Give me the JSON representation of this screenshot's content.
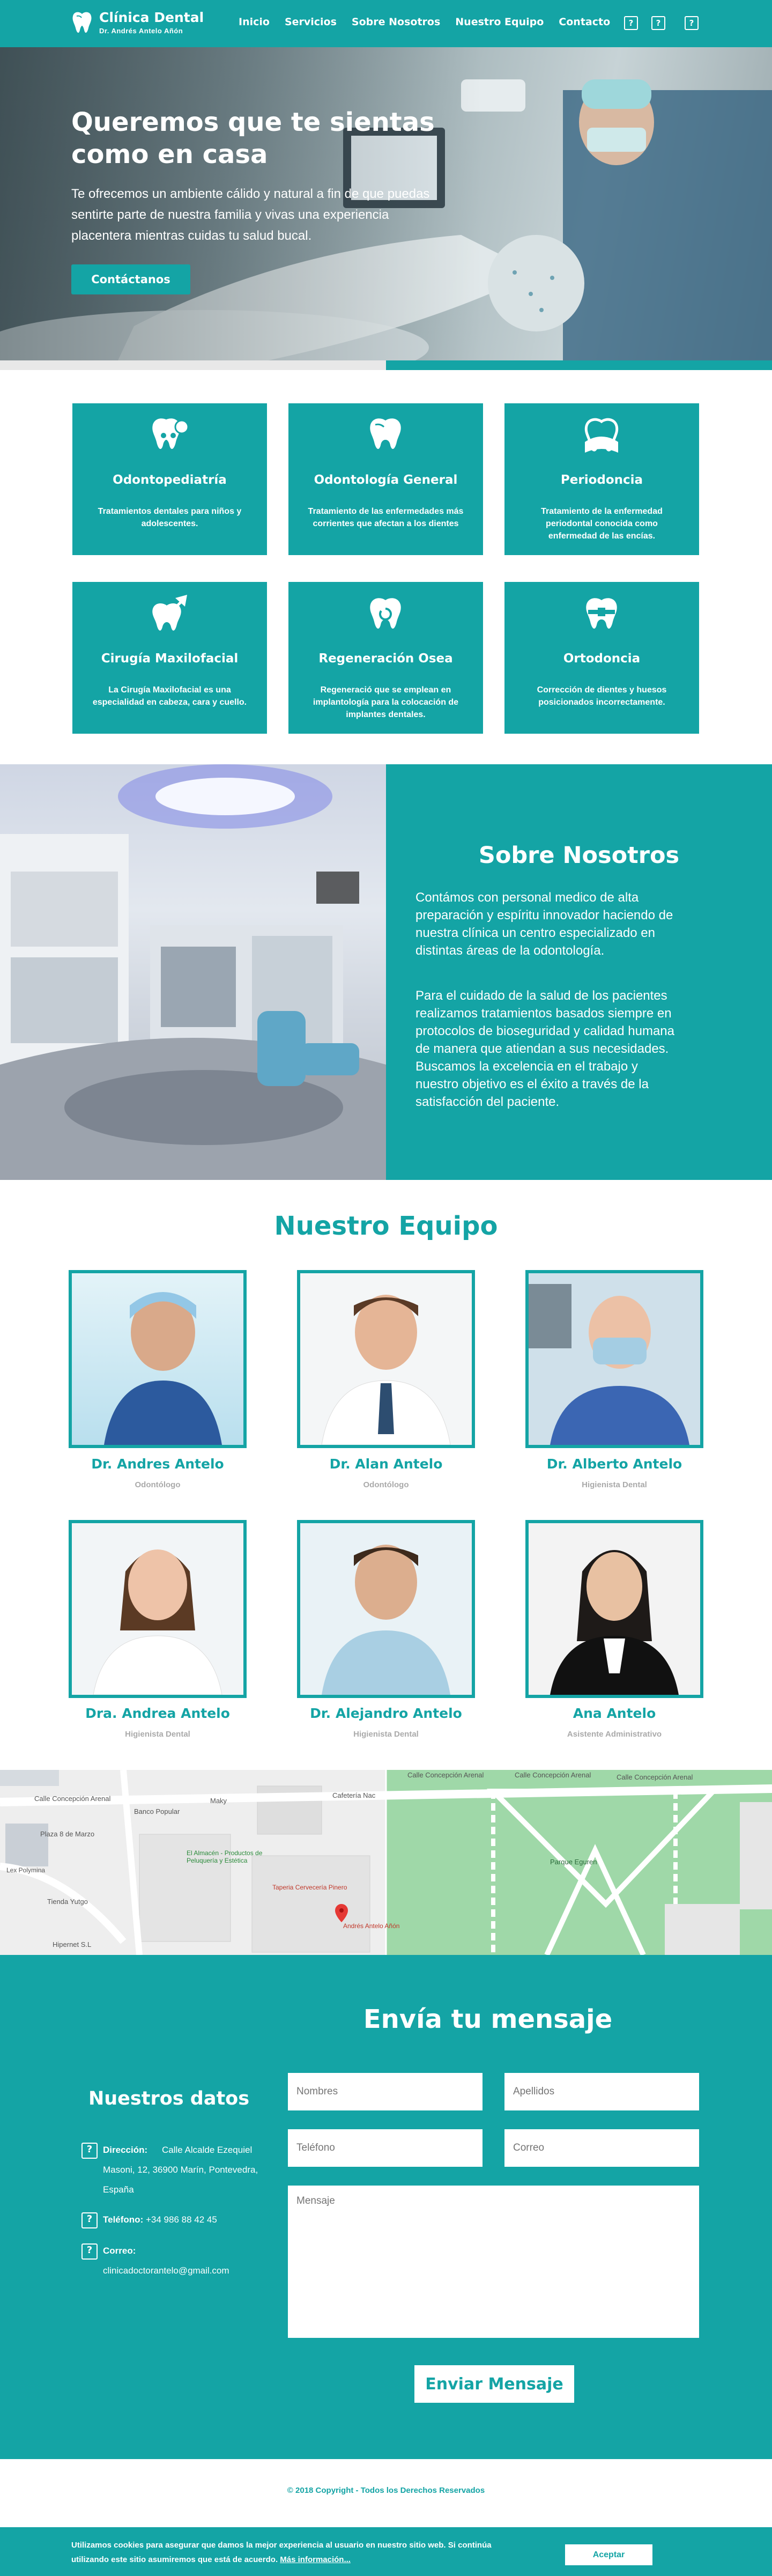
{
  "nav": {
    "brand_title": "Clínica Dental",
    "brand_sub": "Dr.   Andrés Antelo Añón",
    "items": [
      "Inicio",
      "Servicios",
      "Sobre Nosotros",
      "Nuestro Equipo",
      "Contacto"
    ],
    "icons": [
      "?",
      "?",
      "?"
    ]
  },
  "hero": {
    "title": "Queremos que te sientas como en casa",
    "text": "Te ofrecemos un ambiente cálido y natural a fin de que puedas sentirte parte de nuestra familia y vivas una experiencia placentera mientras cuidas tu salud bucal.",
    "button": "Contáctanos"
  },
  "services": [
    {
      "title": "Odontopediatría",
      "desc": "Tratamientos dentales para niños y adolescentes.",
      "icon": "kid-tooth-icon"
    },
    {
      "title": "Odontología General",
      "desc": "Tratamiento de las enfermedades más corrientes que afectan a los dientes",
      "icon": "tooth-icon"
    },
    {
      "title": "Periodoncia",
      "desc": "Tratamiento de la enfermedad periodontal conocida como enfermedad de las encías.",
      "icon": "gum-icon"
    },
    {
      "title": "Cirugía Maxilofacial",
      "desc": "La Cirugía Maxilofacial es una especialidad en cabeza, cara y cuello.",
      "icon": "surgery-tooth-icon"
    },
    {
      "title": "Regeneración Osea",
      "desc": "Regeneració que se emplean en implantología para la colocación de implantes dentales.",
      "icon": "regeneration-tooth-icon"
    },
    {
      "title": "Ortodoncia",
      "desc": "Corrección de dientes y huesos posicionados incorrectamente.",
      "icon": "braces-tooth-icon"
    }
  ],
  "about": {
    "title": "Sobre Nosotros",
    "p1": "Contámos con personal medico de alta preparación y espíritu innovador haciendo de nuestra clínica un centro especializado en distintas áreas de la odontología.",
    "p2": "Para el cuidado de la salud de los pacientes realizamos tratamientos basados siempre en protocolos de bioseguridad y calidad humana de manera que atiendan a sus necesidades. Buscamos la excelencia en el trabajo y nuestro objetivo es el éxito a través de la satisfacción del paciente."
  },
  "team": {
    "title": "Nuestro Equipo",
    "members": [
      {
        "name": "Dr. Andres Antelo",
        "role": "Odontólogo"
      },
      {
        "name": "Dr. Alan Antelo",
        "role": "Odontólogo"
      },
      {
        "name": "Dr. Alberto Antelo",
        "role": "Higienista Dental"
      },
      {
        "name": "Dra. Andrea Antelo",
        "role": "Higienista Dental"
      },
      {
        "name": "Dr. Alejandro Antelo",
        "role": "Higienista Dental"
      },
      {
        "name": "Ana Antelo",
        "role": "Asistente Administrativo"
      }
    ]
  },
  "map": {
    "labels": [
      "Calle Concepción Arenal",
      "Calle Concepción Arenal",
      "Calle Concepción Arenal",
      "Calle Concepción Arenal",
      "Plaza 8 de Marzo",
      "Banco Popular",
      "Maky",
      "Cafetería Nac",
      "El Almacén - Productos de Peluquería y Estética",
      "Taperia Cervecería Pinero",
      "Andrés Antelo Añón",
      "Tienda Yutgo",
      "Hipernet S.L",
      "Parque Eguren",
      "Lex Polymina"
    ]
  },
  "contact": {
    "title": "Envía tu mensaje",
    "placeholders": {
      "name": "Nombres",
      "surname": "Apellidos",
      "phone": "Teléfono",
      "email": "Correo",
      "message": "Mensaje"
    },
    "send": "Enviar Mensaje",
    "data_title": "Nuestros datos",
    "address_label": "Dirección:",
    "address": "Calle Alcalde Ezequiel Masoni, 12, 36900 Marín, Pontevedra, España",
    "phone_label": "Teléfono:",
    "phone": "+34 986 88 42 45",
    "email_label": "Correo:",
    "email": "clinicadoctorantelo@gmail.com"
  },
  "footer": {
    "copyright": "© 2018 Copyright - Todos los Derechos Reservados"
  },
  "cookies": {
    "text": "Utilizamos cookies para asegurar que damos la mejor experiencia al usuario en nuestro sitio web. Si continúa utilizando este sitio asumiremos que está de acuerdo.",
    "link": "Más información...",
    "accept": "Aceptar"
  },
  "colors": {
    "brand": "#14a4a5",
    "muted": "#aaaaaa"
  }
}
